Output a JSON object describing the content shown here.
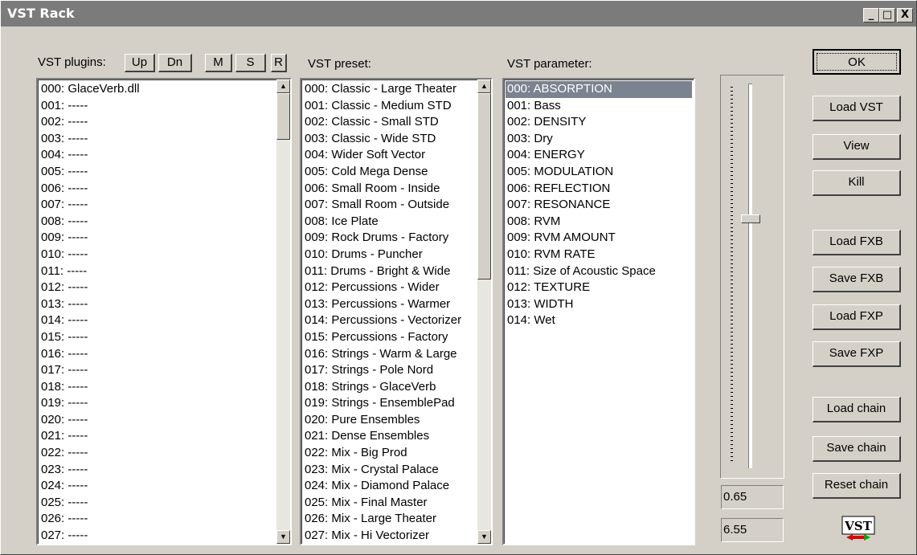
{
  "window": {
    "title": "VST Rack"
  },
  "titlebar_buttons": {
    "minimize": "_",
    "maximize": "□",
    "close": "X"
  },
  "plugins": {
    "label": "VST plugins:",
    "buttons": {
      "up": "Up",
      "dn": "Dn",
      "m": "M",
      "s": "S",
      "r": "R"
    },
    "items": [
      "000: GlaceVerb.dll",
      "001: -----",
      "002: -----",
      "003: -----",
      "004: -----",
      "005: -----",
      "006: -----",
      "007: -----",
      "008: -----",
      "009: -----",
      "010: -----",
      "011: -----",
      "012: -----",
      "013: -----",
      "014: -----",
      "015: -----",
      "016: -----",
      "017: -----",
      "018: -----",
      "019: -----",
      "020: -----",
      "021: -----",
      "022: -----",
      "023: -----",
      "024: -----",
      "025: -----",
      "026: -----",
      "027: -----"
    ]
  },
  "presets": {
    "label": "VST preset:",
    "items": [
      "000: Classic - Large Theater",
      "001: Classic - Medium STD",
      "002: Classic - Small STD",
      "003: Classic - Wide STD",
      "004: Wider Soft Vector",
      "005: Cold Mega Dense",
      "006: Small Room - Inside",
      "007: Small Room - Outside",
      "008: Ice Plate",
      "009: Rock Drums - Factory",
      "010: Drums - Puncher",
      "011: Drums - Bright & Wide",
      "012: Percussions - Wider",
      "013: Percussions - Warmer",
      "014: Percussions - Vectorizer",
      "015: Percussions - Factory",
      "016: Strings  - Warm & Large",
      "017: Strings - Pole Nord",
      "018: Strings - GlaceVerb",
      "019: Strings - EnsemblePad",
      "020: Pure Ensembles",
      "021: Dense Ensembles",
      "022: Mix - Big Prod",
      "023: Mix - Crystal Palace",
      "024: Mix - Diamond Palace",
      "025: Mix - Final Master",
      "026: Mix - Large Theater",
      "027: Mix - Hi Vectorizer"
    ]
  },
  "parameters": {
    "label": "VST parameter:",
    "items": [
      "000: ABSORPTION",
      "001: Bass",
      "002: DENSITY",
      "003: Dry",
      "004: ENERGY",
      "005: MODULATION",
      "006: REFLECTION",
      "007: RESONANCE",
      "008: RVM",
      "009: RVM AMOUNT",
      "010: RVM RATE",
      "011: Size of Acoustic Space",
      "012: TEXTURE",
      "013: WIDTH",
      "014: Wet"
    ]
  },
  "slider": {
    "value_display": "0.65",
    "raw_display": "6.55",
    "level": 0.65
  },
  "buttons": {
    "ok": "OK",
    "load_vst": "Load VST",
    "view": "View",
    "kill": "Kill",
    "load_fxb": "Load FXB",
    "save_fxb": "Save FXB",
    "load_fxp": "Load FXP",
    "save_fxp": "Save FXP",
    "load_chain": "Load chain",
    "save_chain": "Save chain",
    "reset_chain": "Reset chain"
  },
  "logo": {
    "text": "VST",
    "icon": "vst-logo-icon"
  }
}
